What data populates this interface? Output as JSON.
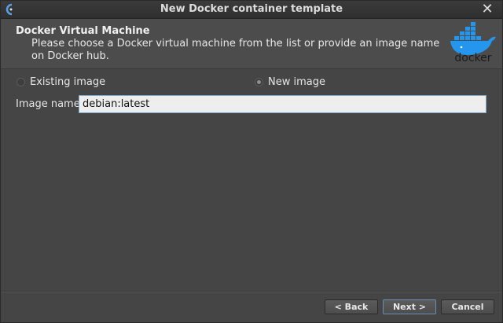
{
  "window": {
    "title": "New Docker container template"
  },
  "header": {
    "title": "Docker Virtual Machine",
    "description": "Please choose a Docker virtual machine from the list or provide an image name on Docker hub.",
    "logo_text": "docker"
  },
  "source": {
    "existing_label": "Existing image",
    "new_label": "New image",
    "selected": "new"
  },
  "image": {
    "label": "Image name:",
    "value": "debian:latest"
  },
  "buttons": {
    "back": "< Back",
    "next": "Next >",
    "cancel": "Cancel"
  },
  "colors": {
    "docker_blue": "#2496ed",
    "accent_border": "#7ea6c9"
  }
}
